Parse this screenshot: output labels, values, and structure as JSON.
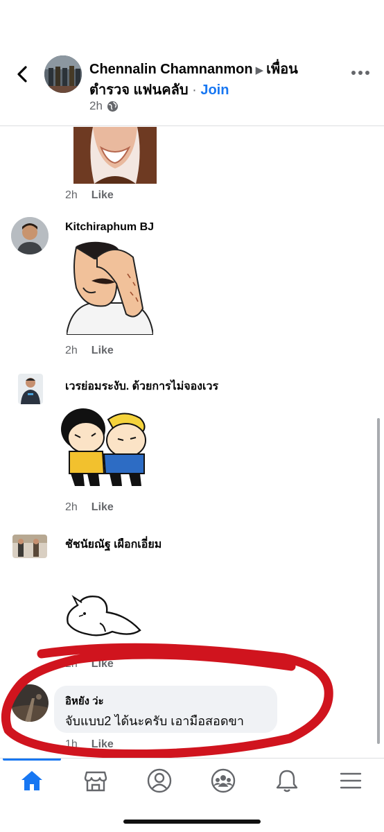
{
  "header": {
    "author": "Chennalin Chamnanmon",
    "group_line1": "เพื่อน",
    "group_line2": "ตำรวจ แฟนคลับ",
    "separator": "·",
    "join_label": "Join",
    "time": "2h",
    "arrow": "▶"
  },
  "comments": [
    {
      "name": "",
      "time": "2h",
      "like_label": "Like",
      "sticker": "woman-sticker"
    },
    {
      "name": "Kitchiraphum BJ",
      "time": "2h",
      "like_label": "Like",
      "sticker": "facepalm-sticker"
    },
    {
      "name": "เวรย่อมระงับ. ด้วยการไม่จองเวร",
      "time": "2h",
      "like_label": "Like",
      "sticker": "hug-sticker"
    },
    {
      "name": "ชัชนัยณัฐ เผือกเอี่ยม",
      "time": "2h",
      "like_label": "Like",
      "sticker": "lying-cat-sticker"
    },
    {
      "name": "อิหยัง ว่ะ",
      "text": "จับแบบ2 ได้นะครับ เอามือสอดขา",
      "time": "1h",
      "like_label": "Like"
    }
  ],
  "annotation": {
    "color": "#d0141e",
    "shape": "hand-drawn-circle"
  },
  "nav": [
    {
      "name": "home",
      "icon": "home-icon",
      "active": true
    },
    {
      "name": "marketplace",
      "icon": "marketplace-icon",
      "active": false
    },
    {
      "name": "profile",
      "icon": "profile-icon",
      "active": false
    },
    {
      "name": "groups",
      "icon": "groups-icon",
      "active": false
    },
    {
      "name": "notifications",
      "icon": "bell-icon",
      "active": false
    },
    {
      "name": "menu",
      "icon": "menu-icon",
      "active": false
    }
  ],
  "colors": {
    "accent": "#1877f2",
    "secondary_text": "#65676b",
    "bubble": "#f0f2f5"
  }
}
